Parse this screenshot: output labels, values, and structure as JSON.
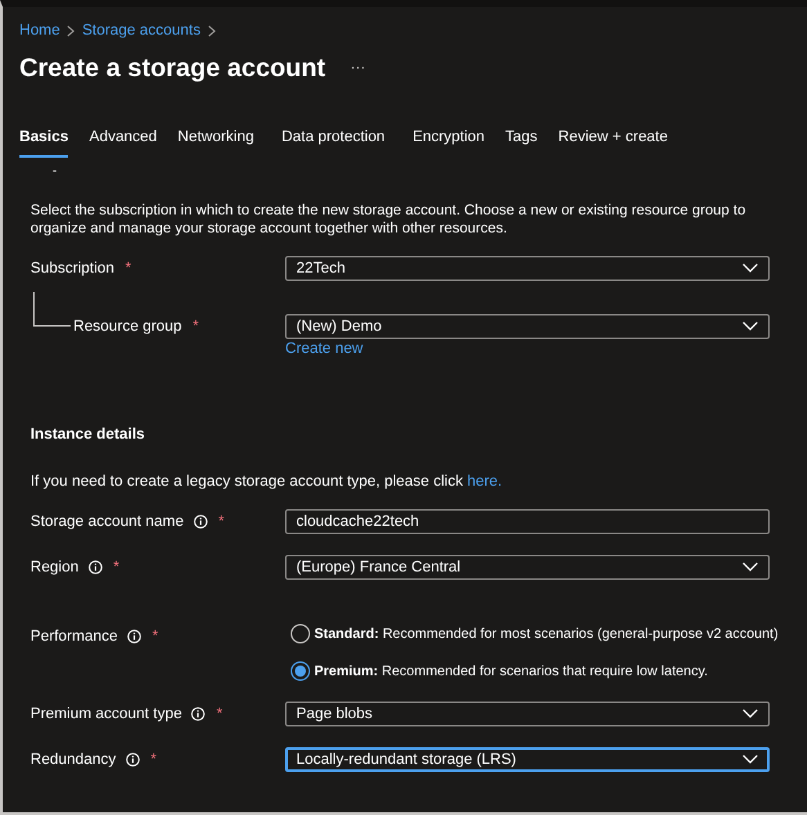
{
  "breadcrumb": [
    {
      "label": "Home"
    },
    {
      "label": "Storage accounts"
    }
  ],
  "title": "Create a storage account",
  "more_button": "···",
  "tabs": [
    {
      "label": "Basics",
      "selected": true
    },
    {
      "label": "Advanced",
      "selected": false
    },
    {
      "label": "Networking",
      "selected": false
    },
    {
      "label": "Data protection",
      "selected": false
    },
    {
      "label": "Encryption",
      "selected": false
    },
    {
      "label": "Tags",
      "selected": false
    },
    {
      "label": "Review + create",
      "selected": false
    }
  ],
  "stray_mark": "-",
  "description": "Select the subscription in which to create the new storage account. Choose a new or existing resource group to organize and manage your storage account together with other resources.",
  "project_fields": [
    {
      "kind": "select",
      "label": "Subscription",
      "required_mark": "*",
      "value": "22Tech"
    },
    {
      "kind": "select",
      "label": "Resource group",
      "required_mark": "*",
      "nested": true,
      "value": "(New) Demo",
      "link": "Create new"
    }
  ],
  "instance_details": {
    "heading": "Instance details",
    "note": "If you need to create a legacy storage account type, please click",
    "note_link": "here.",
    "fields": [
      {
        "kind": "text",
        "label": "Storage account name",
        "required_mark": "*",
        "info": true,
        "value": "cloudcache22tech"
      },
      {
        "kind": "select",
        "label": "Region",
        "required_mark": "*",
        "info": true,
        "value": "(Europe) France Central"
      },
      {
        "kind": "radio",
        "label": "Performance",
        "required_mark": "*",
        "info": true,
        "options": [
          {
            "title": "Standard:",
            "description": "Recommended for most scenarios (general-purpose v2 account)",
            "selected": false
          },
          {
            "title": "Premium:",
            "description": "Recommended for scenarios that require low latency.",
            "selected": true
          }
        ]
      },
      {
        "kind": "select",
        "label": "Premium account type",
        "required_mark": "*",
        "info": true,
        "value": "Page blobs"
      },
      {
        "kind": "select",
        "label": "Redundancy",
        "required_mark": "*",
        "info": true,
        "focused": true,
        "value": "Locally-redundant storage (LRS)"
      }
    ]
  }
}
